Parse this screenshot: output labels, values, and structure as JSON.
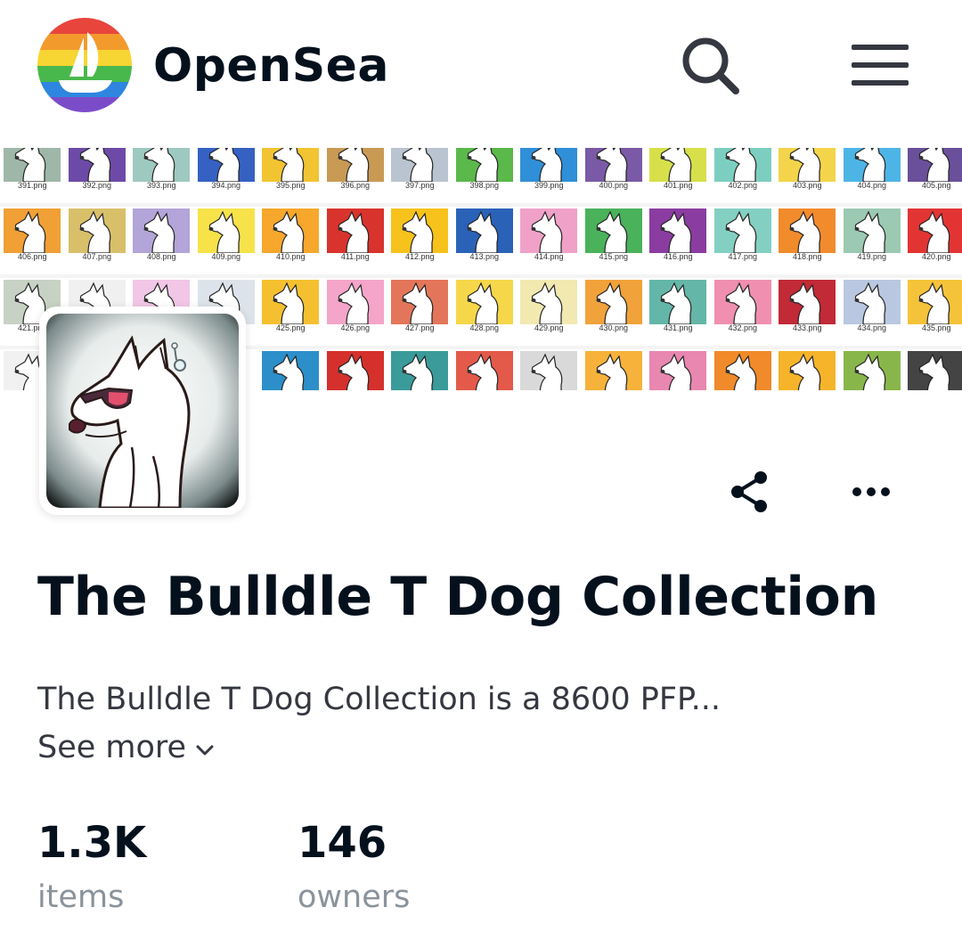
{
  "header": {
    "brand": "OpenSea",
    "logo_icon": "opensea-boat-rainbow-logo",
    "search_icon": "search-icon",
    "menu_icon": "hamburger-menu-icon"
  },
  "banner": {
    "rows": [
      [
        "391.png",
        "392.png",
        "393.png",
        "394.png",
        "395.png",
        "396.png",
        "397.png",
        "398.png",
        "399.png",
        "400.png",
        "401.png",
        "402.png",
        "403.png",
        "404.png",
        "405.png"
      ],
      [
        "406.png",
        "407.png",
        "408.png",
        "409.png",
        "410.png",
        "411.png",
        "412.png",
        "413.png",
        "414.png",
        "415.png",
        "416.png",
        "417.png",
        "418.png",
        "419.png",
        "420.png"
      ],
      [
        "421.png",
        "",
        "",
        "",
        "425.png",
        "426.png",
        "427.png",
        "428.png",
        "429.png",
        "430.png",
        "431.png",
        "432.png",
        "433.png",
        "434.png",
        "435.png"
      ],
      [
        "",
        "",
        "",
        "",
        "",
        "",
        "",
        "",
        "",
        "",
        "",
        "",
        "",
        "",
        ""
      ]
    ],
    "tile_colors": [
      [
        "#9fb7a8",
        "#6e4aa8",
        "#9ec9c0",
        "#3561c2",
        "#f2c432",
        "#c99a54",
        "#b9c4d0",
        "#5bb84a",
        "#2f8fd8",
        "#7a5aa6",
        "#d7e04a",
        "#7ccfc0",
        "#f4d44a",
        "#4db5e6",
        "#6a4f9a"
      ],
      [
        "#f0a035",
        "#d8c06a",
        "#b3a4d9",
        "#f7e24a",
        "#f6a72c",
        "#d8332c",
        "#f7c21b",
        "#2a62b8",
        "#f0a1c8",
        "#49b25a",
        "#8a3ca0",
        "#83d0c2",
        "#f28b2c",
        "#9cc9b2",
        "#e33434"
      ],
      [
        "#c7d2c4",
        "#f0f0f0",
        "#f2c6e6",
        "#dde3ea",
        "#f5c030",
        "#f4a5c9",
        "#e3765a",
        "#f6d74a",
        "#f1e9b0",
        "#f1a23a",
        "#64b6a8",
        "#f08fb0",
        "#c12a36",
        "#b9c8e0",
        "#f5c33a"
      ],
      [
        "#f1f1f1",
        "#ffffff",
        "#ffffff",
        "#ffffff",
        "#2c8fc9",
        "#d5302c",
        "#3a9b9a",
        "#e35a4a",
        "#d9d9d9",
        "#f6b23a",
        "#e887b0",
        "#f08a2a",
        "#f5b42a",
        "#89b64a",
        "#444444"
      ]
    ]
  },
  "avatar": {
    "icon": "bull-terrier-sunglasses-avatar"
  },
  "actions": {
    "share_icon": "share-icon",
    "more_icon": "more-horizontal-icon"
  },
  "collection": {
    "title": "The Bulldle T Dog Collection",
    "description": "The Bulldle T Dog Collection is a 8600 PFP...",
    "see_more": "See more"
  },
  "stats": {
    "items_value": "1.3K",
    "items_label": "items",
    "owners_value": "146",
    "owners_label": "owners"
  }
}
